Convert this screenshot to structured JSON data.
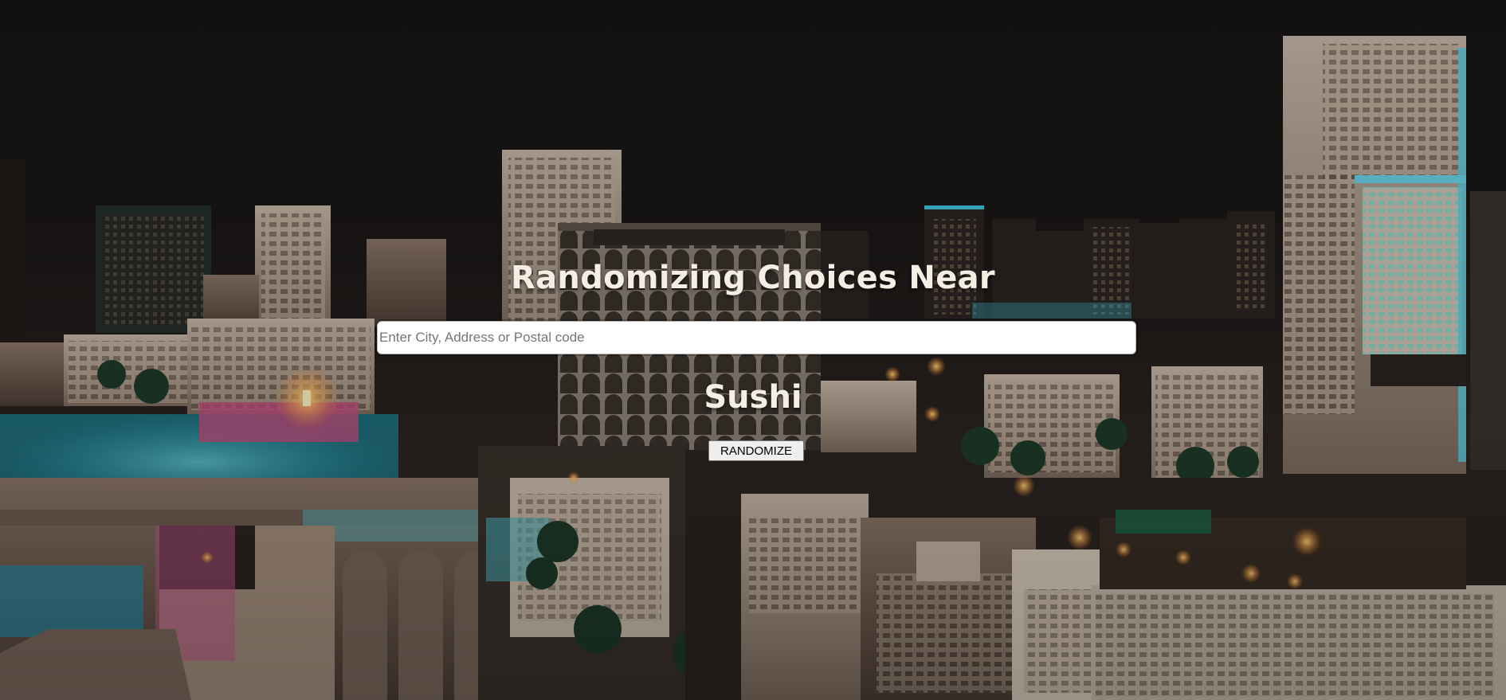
{
  "header": {
    "title": "Randomizing Choices Near"
  },
  "search": {
    "value": "",
    "placeholder": "Enter City, Address or Postal code"
  },
  "result": {
    "choice": "Sushi"
  },
  "actions": {
    "randomize_label": "RANDOMIZE"
  },
  "background": {
    "description_icon": "city-night-skyline-image",
    "sky_color": "#1a1716",
    "accent_light_color": "#f2a54a",
    "accent_cyan_color": "#3fc6e0"
  }
}
